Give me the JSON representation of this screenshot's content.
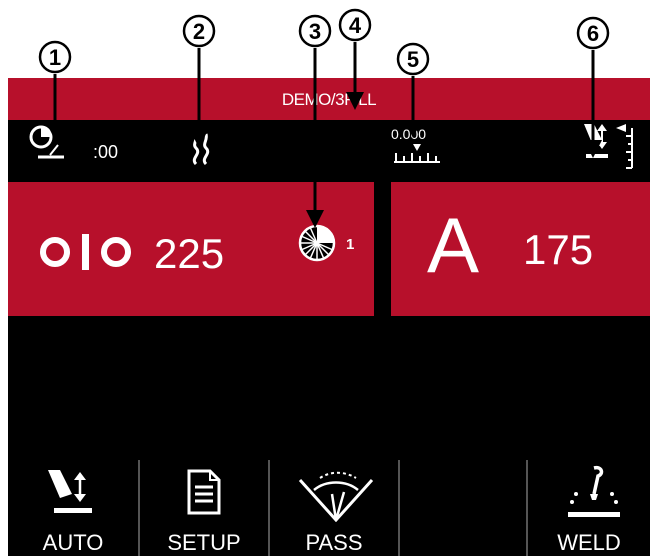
{
  "header": {
    "title": "DEMO/3FILL"
  },
  "status": {
    "timer_value": ":00",
    "scale_value": "0.000"
  },
  "left_display": {
    "value": "225"
  },
  "center_display": {
    "pass_number": "1"
  },
  "right_display": {
    "symbol": "A",
    "value": "175"
  },
  "bottom_tabs": [
    {
      "label": "AUTO"
    },
    {
      "label": "SETUP"
    },
    {
      "label": "PASS"
    },
    {
      "label": ""
    },
    {
      "label": "WELD"
    }
  ],
  "callouts": [
    "1",
    "2",
    "3",
    "4",
    "5",
    "6"
  ],
  "colors": {
    "accent_red": "#b7102b",
    "screen_bg": "#000000",
    "text": "#ffffff"
  }
}
